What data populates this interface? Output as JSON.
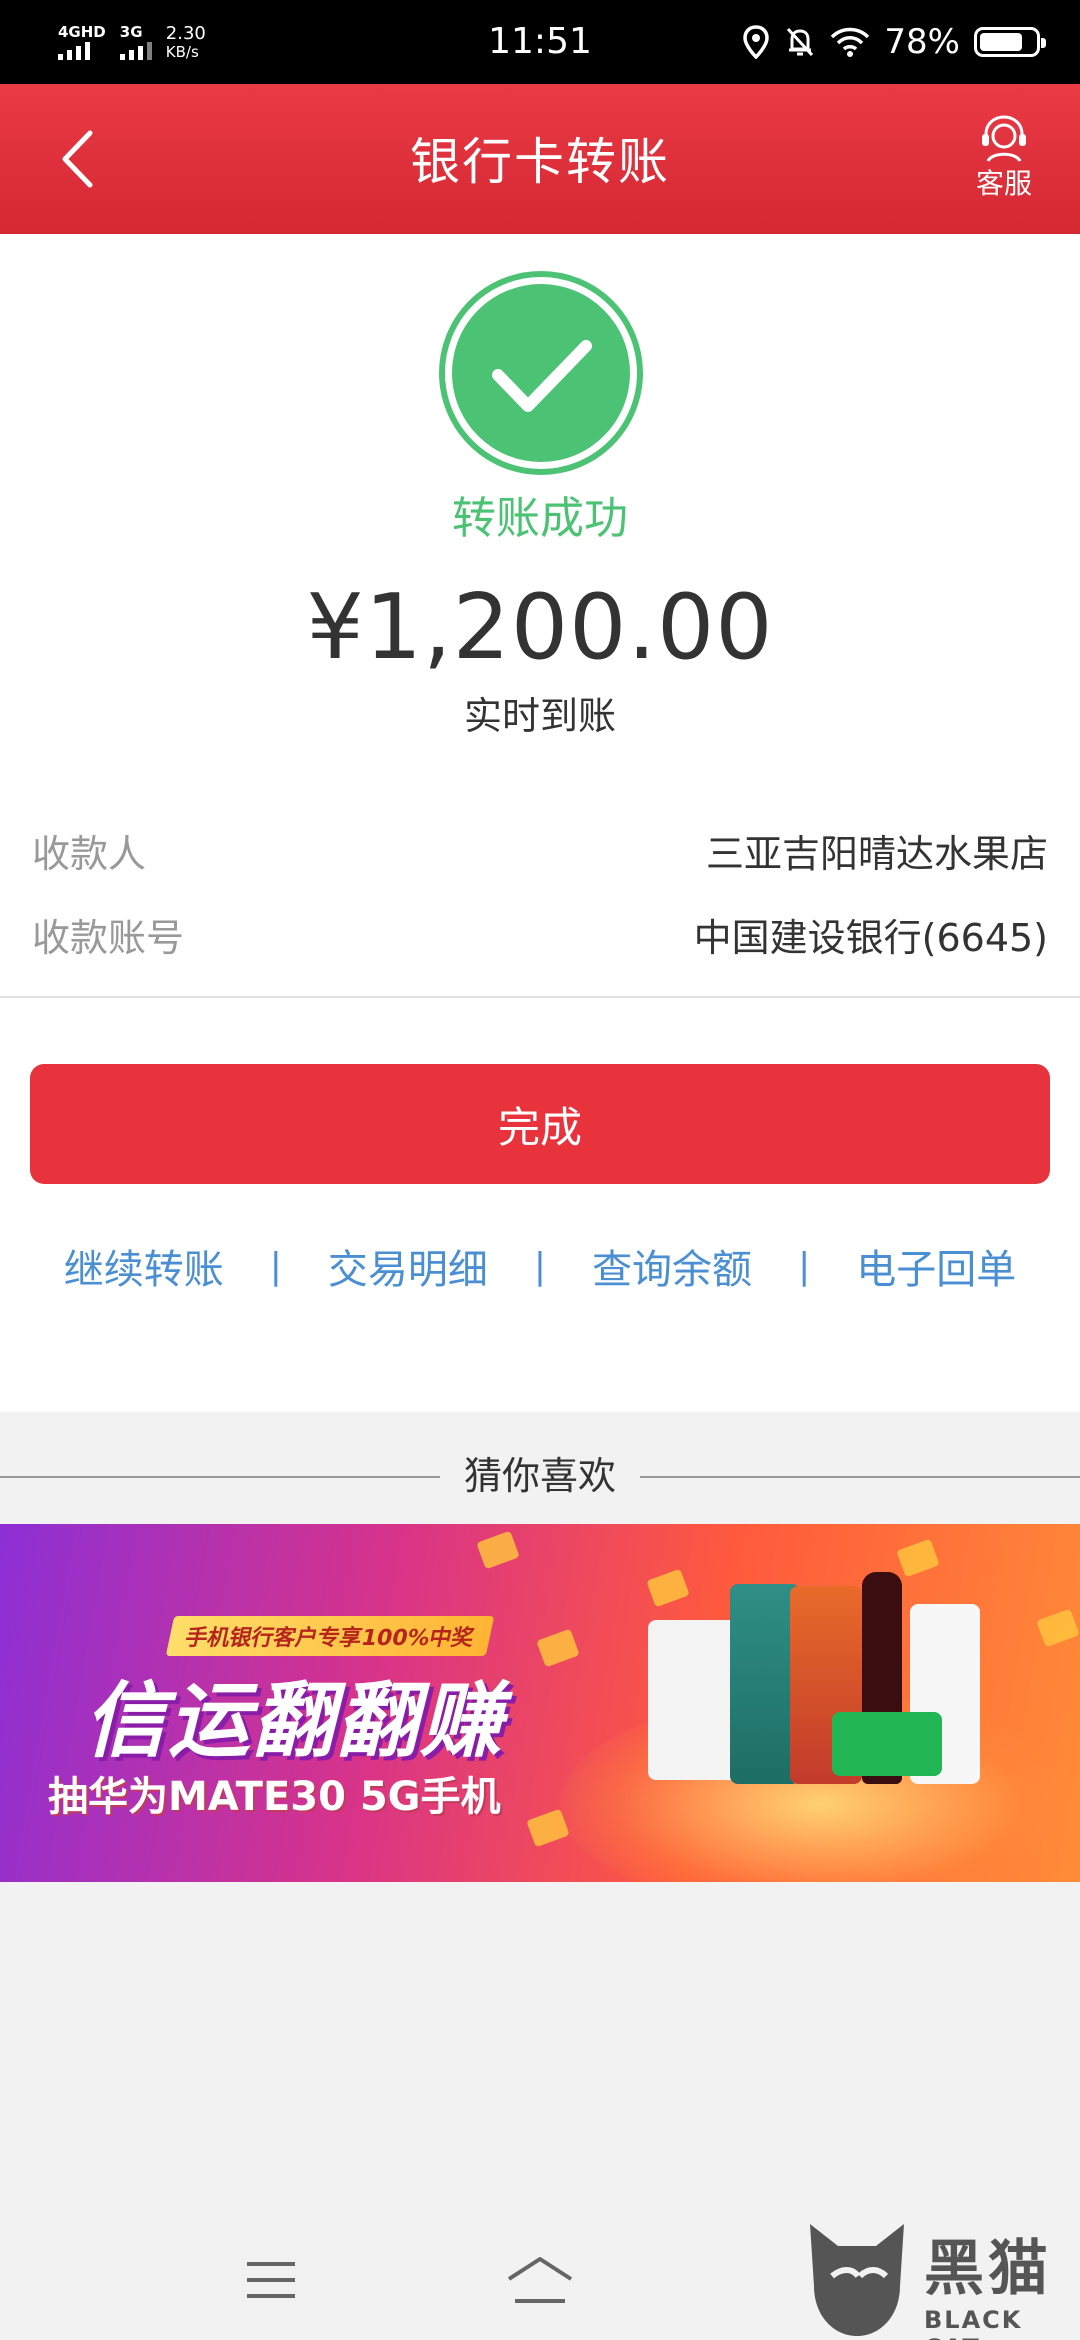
{
  "status_bar": {
    "network_1": "4GHD",
    "network_2": "3G",
    "speed_value": "2.30",
    "speed_unit": "KB/s",
    "time": "11:51",
    "battery": "78%",
    "battery_level": 0.78
  },
  "header": {
    "title": "银行卡转账",
    "service_label": "客服"
  },
  "result": {
    "status_text": "转账成功",
    "amount": "¥1,200.00",
    "arrival": "实时到账",
    "status_color": "#4cc274"
  },
  "details": [
    {
      "label": "收款人",
      "value": "三亚吉阳晴达水果店"
    },
    {
      "label": "收款账号",
      "value": "中国建设银行(6645)"
    }
  ],
  "done_button": "完成",
  "links": [
    "继续转账",
    "交易明细",
    "查询余额",
    "电子回单"
  ],
  "link_separator": "|",
  "recommend_title": "猜你喜欢",
  "banner": {
    "ribbon": "手机银行客户专享100%中奖",
    "headline": "信运翻翻赚",
    "subline": "抽华为MATE30 5G手机"
  },
  "watermark": {
    "cn": "黑猫",
    "en": "BLACK CAT"
  },
  "colors": {
    "brand_red": "#e8333d",
    "link_blue": "#4a8fd2"
  }
}
